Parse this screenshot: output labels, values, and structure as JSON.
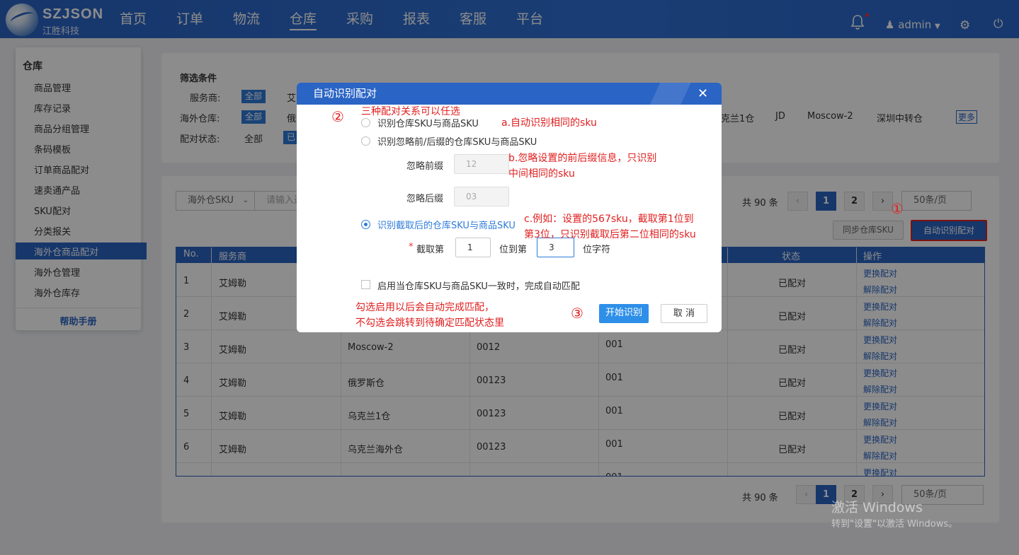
{
  "app": {
    "logo": "SZJSON",
    "logo_sub": "江胜科技",
    "user": "admin"
  },
  "nav": [
    "首页",
    "订单",
    "物流",
    "仓库",
    "采购",
    "报表",
    "客服",
    "平台"
  ],
  "sidebar": {
    "title": "仓库",
    "items": [
      "商品管理",
      "库存记录",
      "商品分组管理",
      "条码模板",
      "订单商品配对",
      "速卖通产品",
      "SKU配对",
      "分类报关",
      "海外仓商品配对",
      "海外仓管理",
      "海外仓库存"
    ],
    "help": "帮助手册"
  },
  "filter": {
    "title": "筛选条件",
    "service_label": "服务商:",
    "service_all": "全部",
    "service_first": "艾",
    "warehouse_label": "海外仓库:",
    "warehouse_all": "全部",
    "warehouse_first": "俄",
    "warehouse_tail": [
      "克兰1仓",
      "JD",
      "Moscow-2",
      "深圳中转仓"
    ],
    "more": "更多",
    "status_label": "配对状态:",
    "status_all": "全部",
    "status_second": "已"
  },
  "toolbar": {
    "sku_select": "海外仓SKU",
    "search_placeholder": "请输入选",
    "total": "共 90 条",
    "page1": "1",
    "page2": "2",
    "page_size": "50条/页",
    "sync_btn": "同步仓库SKU",
    "auto_btn": "自动识别配对"
  },
  "table": {
    "headers": [
      "No.",
      "服务商",
      "状态",
      "操作"
    ],
    "rows": [
      {
        "no": "1",
        "provider": "艾姆勒",
        "wh": "",
        "sku": "",
        "code": "",
        "status": "已配对"
      },
      {
        "no": "2",
        "provider": "艾姆勒",
        "wh": "",
        "sku": "",
        "code": "",
        "status": "已配对"
      },
      {
        "no": "3",
        "provider": "艾姆勒",
        "wh": "Moscow-2",
        "sku": "0012",
        "code": "001",
        "status": "已配对"
      },
      {
        "no": "4",
        "provider": "艾姆勒",
        "wh": "俄罗斯仓",
        "sku": "00123",
        "code": "001",
        "status": "已配对"
      },
      {
        "no": "5",
        "provider": "艾姆勒",
        "wh": "乌克兰1仓",
        "sku": "00123",
        "code": "001",
        "status": "已配对"
      },
      {
        "no": "6",
        "provider": "艾姆勒",
        "wh": "乌克兰海外仓",
        "sku": "00123",
        "code": "001",
        "status": "已配对"
      },
      {
        "no": "",
        "provider": "",
        "wh": "",
        "sku": "",
        "code": "001",
        "status": ""
      }
    ],
    "op1": "更换配对",
    "op2": "解除配对"
  },
  "dialog": {
    "title": "自动识别配对",
    "opt1": "识别仓库SKU与商品SKU",
    "opt2": "识别忽略前/后缀的仓库SKU与商品SKU",
    "prefix_label": "忽略前缀",
    "prefix_val": "12",
    "suffix_label": "忽略后缀",
    "suffix_val": "03",
    "opt3": "识别截取后的仓库SKU与商品SKU",
    "cut_label": "截取第",
    "cut_from": "1",
    "cut_mid": "位到第",
    "cut_to": "3",
    "cut_end": "位字符",
    "checkbox": "启用当仓库SKU与商品SKU一致时，完成自动匹配",
    "start": "开始识别",
    "cancel": "取 消",
    "required": "*"
  },
  "annotations": {
    "c1": "①",
    "c2": "②",
    "c3": "③",
    "a2": "三种配对关系可以任选",
    "a": "a.自动识别相同的sku",
    "b1": "b.忽略设置的前后缀信息，只识别",
    "b2": "中间相同的sku",
    "c_1": "c.例如：设置的567sku，截取第1位到",
    "c_2": "第3位，只识别截取后第二位相同的sku",
    "d1": "勾选启用以后会自动完成匹配，",
    "d2": "不勾选会跳转到待确定匹配状态里"
  },
  "watermark": {
    "l1": "激活 Windows",
    "l2": "转到\"设置\"以激活 Windows。"
  },
  "colors": {
    "primary": "#2a64c4",
    "tag": "#2e7bd9",
    "annotation": "#e02020"
  }
}
